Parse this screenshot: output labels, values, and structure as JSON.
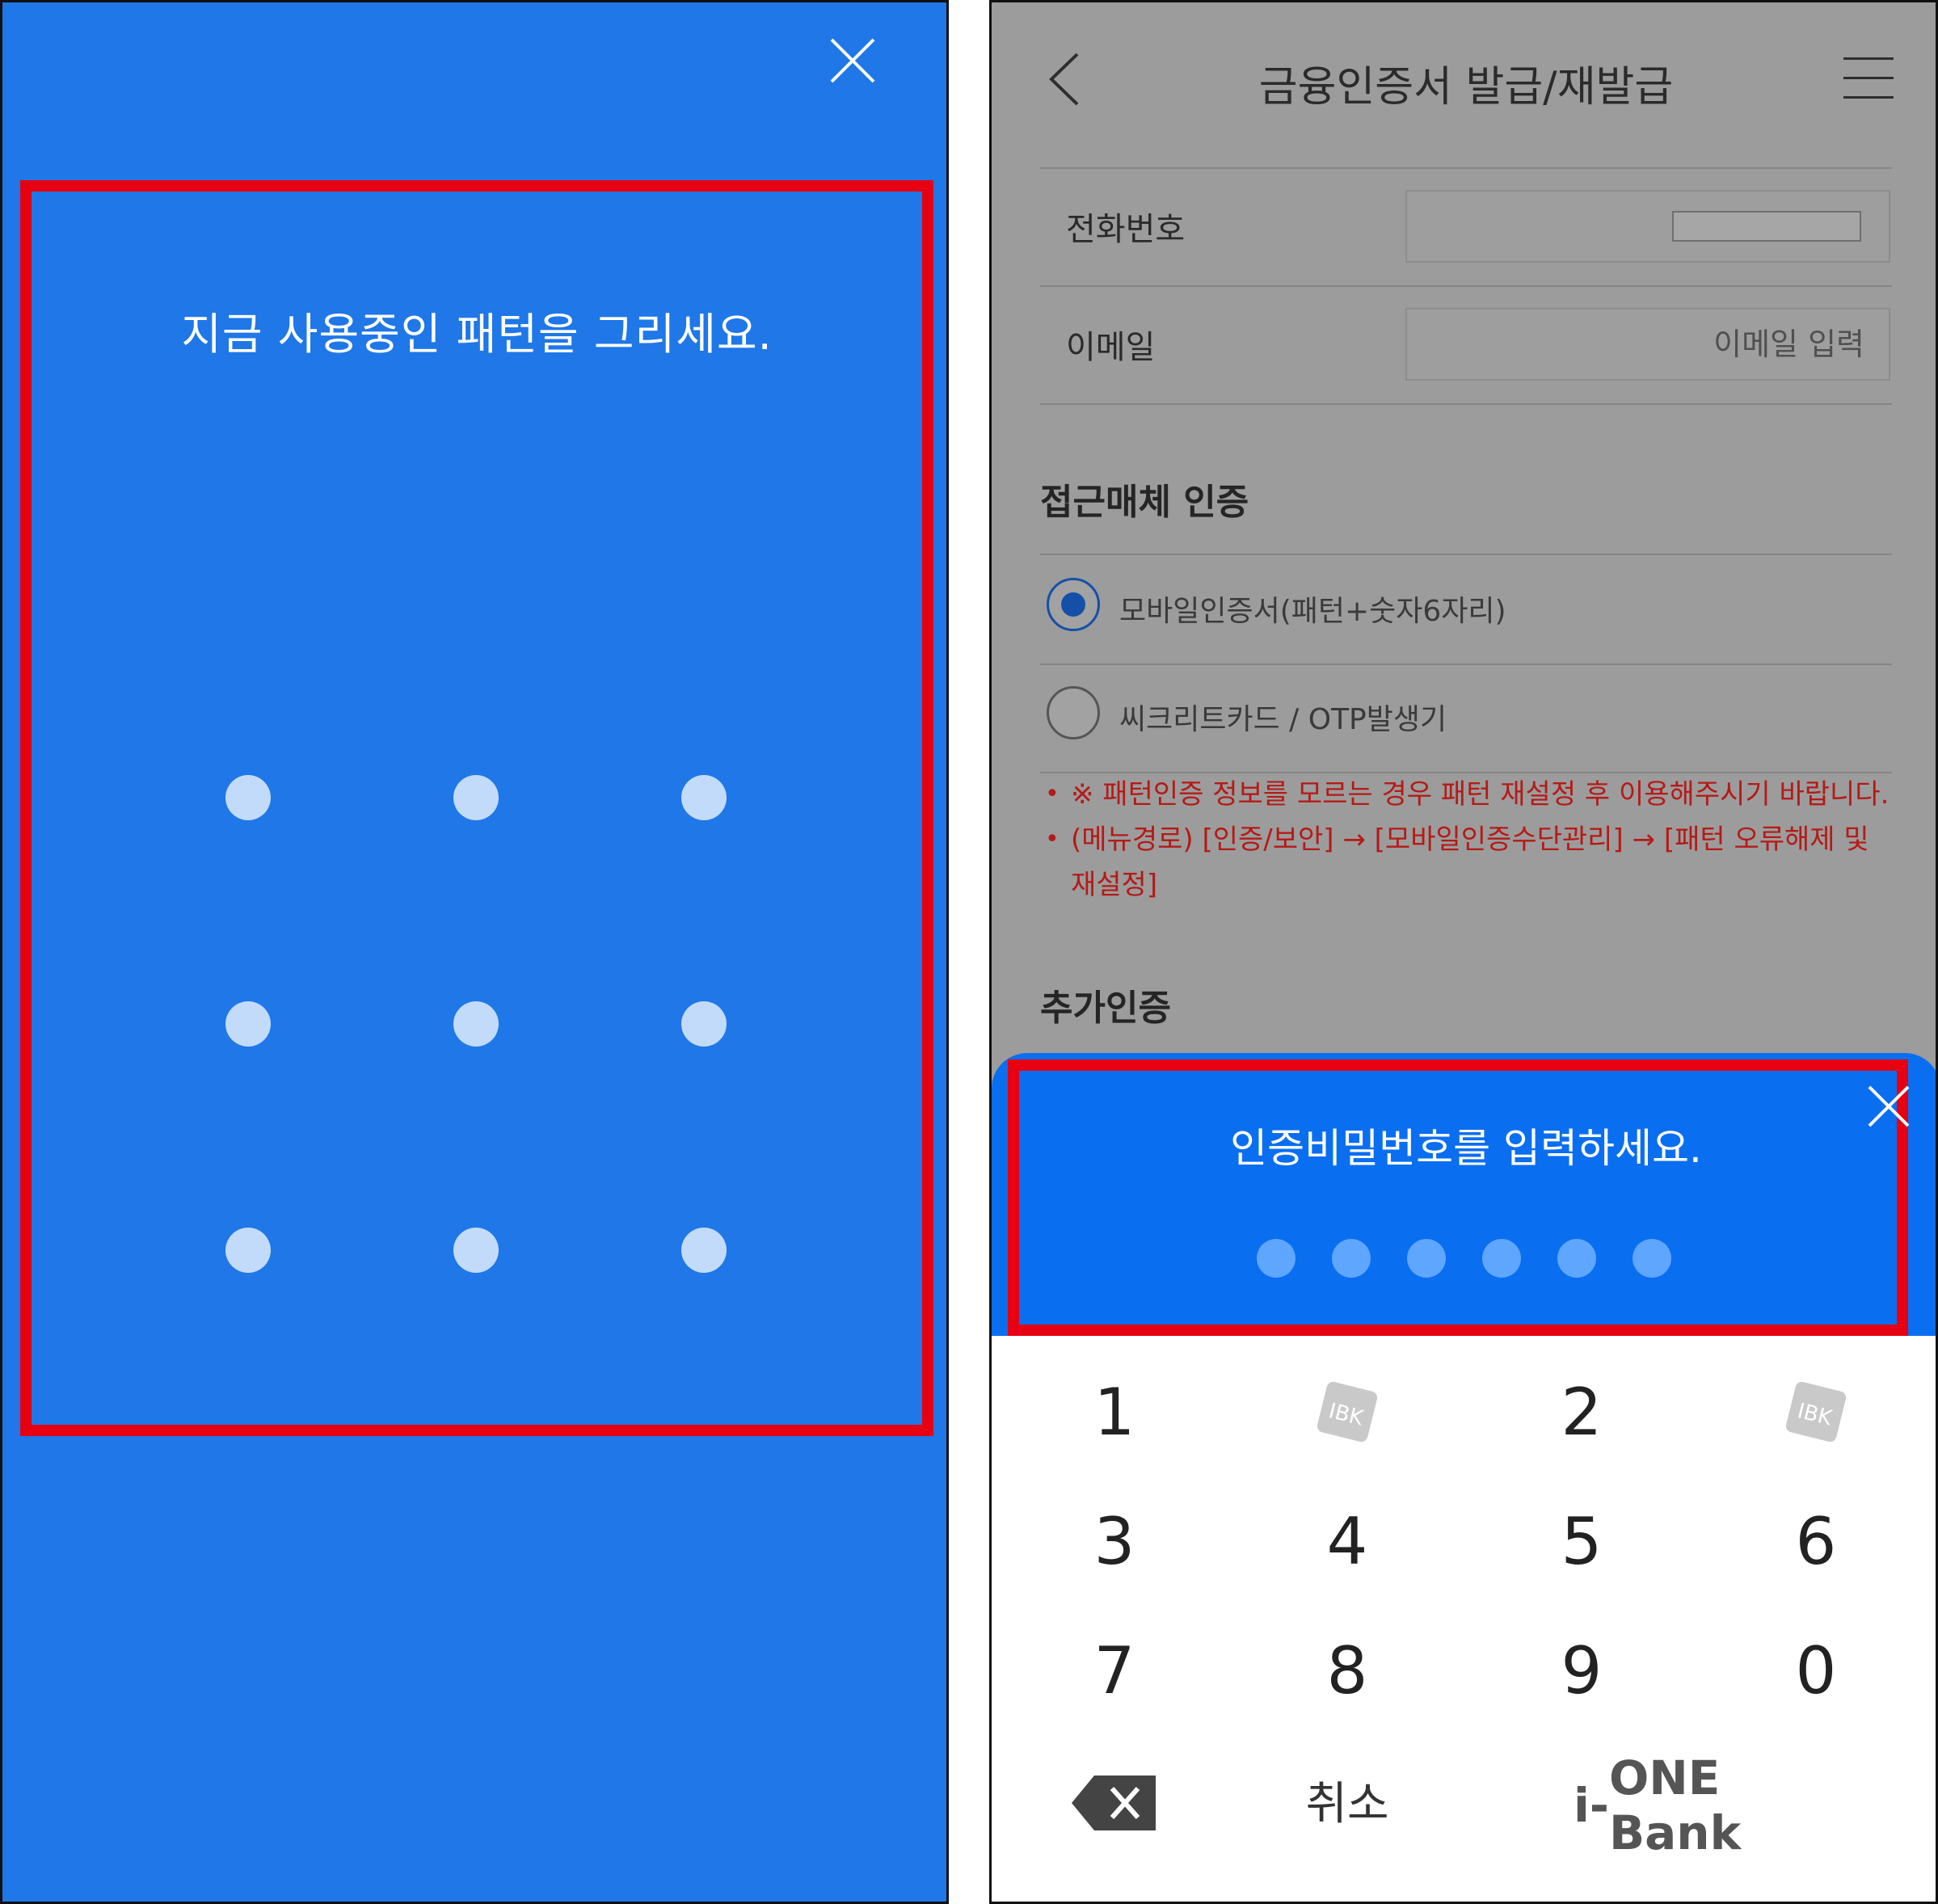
{
  "pattern_screen": {
    "title": "지금 사용중인 패턴을 그리세요.",
    "dot_count": 9,
    "close_icon": "close-icon",
    "colors": {
      "background": "#1f77e8",
      "dot": "#c3dbfb",
      "highlight_frame": "#e60012"
    }
  },
  "cert_screen": {
    "header": {
      "title": "금융인증서 발급/재발급",
      "back_icon": "chevron-left-icon",
      "menu_icon": "hamburger-menu-icon"
    },
    "form": {
      "phone_label": "전화번호",
      "email_label": "이메일",
      "email_placeholder": "이메일 입력"
    },
    "access_auth": {
      "title": "접근매체 인증",
      "options": [
        {
          "label": "모바일인증서(패턴+숫자6자리)",
          "selected": true
        },
        {
          "label": "씨크리트카드 / OTP발생기",
          "selected": false
        }
      ],
      "notices": [
        {
          "bullet": "•",
          "text": "※ 패턴인증 정보를 모르는 경우 패턴 재설정 후 이용해주시기 바랍니다."
        },
        {
          "bullet": "•",
          "text": "(메뉴경로) [인증/보안] → [모바일인증수단관리] → [패턴 오류해제 및 재설정]"
        }
      ]
    },
    "extra_auth_title": "추가인증",
    "pin_sheet": {
      "title": "인증비밀번호를 입력하세요.",
      "pin_length": 6,
      "close_icon": "close-icon",
      "colors": {
        "background": "#0a6ef0",
        "dot": "#5ea6ff"
      }
    },
    "keypad": {
      "rows": [
        [
          "1",
          "",
          "2",
          ""
        ],
        [
          "3",
          "4",
          "5",
          "6"
        ],
        [
          "7",
          "8",
          "9",
          "0"
        ]
      ],
      "blank_key_icon": "ibk-logo-icon",
      "backspace_icon": "backspace-icon",
      "cancel_label": "취소",
      "brand_prefix": "i-",
      "brand_name": "ONE Bank"
    },
    "colors": {
      "dim_background": "#9c9c9c",
      "notice_text": "#b51a16",
      "radio_selected": "#1450a8"
    }
  }
}
